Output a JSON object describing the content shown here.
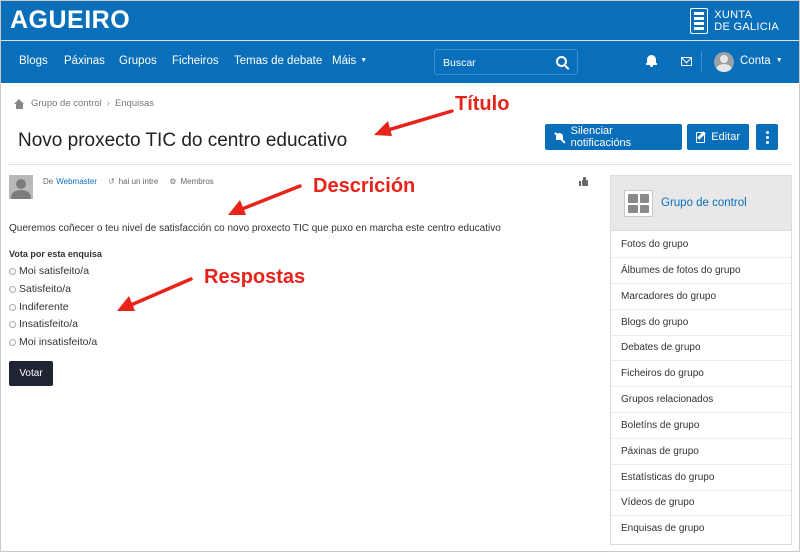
{
  "brand": {
    "name": "AGUEIRO",
    "partner_line1": "XUNTA",
    "partner_line2": "DE GALICIA"
  },
  "nav": {
    "items": [
      "Blogs",
      "Páxinas",
      "Grupos",
      "Ficheiros",
      "Temas de debate",
      "Máis"
    ],
    "search_placeholder": "Buscar",
    "account_label": "Conta"
  },
  "breadcrumb": [
    "Grupo de control",
    "Enquisas"
  ],
  "page": {
    "title": "Novo proxecto TIC do centro educativo",
    "mute_label": "Silenciar notificacións",
    "edit_label": "Editar"
  },
  "post": {
    "by_prefix": "De",
    "author": "Webmaster",
    "time": "hai un intre",
    "access": "Membros",
    "description": "Queremos coñecer o teu nivel de satisfacción co novo proxecto TIC que puxo en marcha este centro educativo",
    "vote_label": "Vota por esta enquisa",
    "options": [
      "Moi satisfeito/a",
      "Satisfeito/a",
      "Indiferente",
      "Insatisfeito/a",
      "Moi insatisfeito/a"
    ],
    "vote_button": "Votar"
  },
  "annotations": {
    "title": "Título",
    "description": "Descrición",
    "answers": "Respostas",
    "color": "#e8231a"
  },
  "sidebar": {
    "group_name": "Grupo de control",
    "links": [
      "Fotos do grupo",
      "Álbumes de fotos do grupo",
      "Marcadores do grupo",
      "Blogs do grupo",
      "Debates de grupo",
      "Ficheiros do grupo",
      "Grupos relacionados",
      "Boletíns de grupo",
      "Páxinas de grupo",
      "Estatísticas do grupo",
      "Vídeos de grupo",
      "Enquisas de grupo"
    ]
  },
  "colors": {
    "brand_blue": "#0a6fba",
    "vote_button": "#1f2433",
    "link": "#0a6fba"
  }
}
